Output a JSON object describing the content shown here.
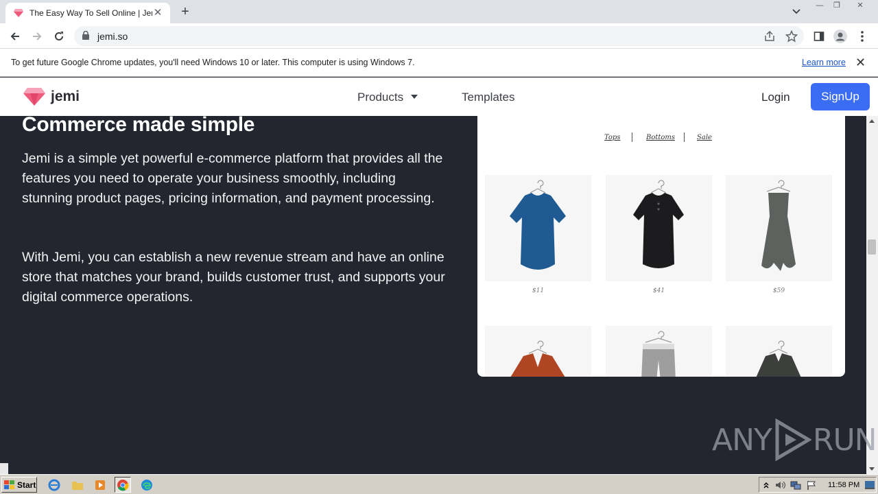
{
  "browser": {
    "tab": {
      "title": "The Easy Way To Sell Online | Jemi",
      "close": "✕"
    },
    "new_tab": "+",
    "url": "jemi.so",
    "window_controls": {
      "minimize": "—",
      "maximize": "❐",
      "close": "✕"
    }
  },
  "infobar": {
    "message": "To get future Google Chrome updates, you'll need Windows 10 or later. This computer is using Windows 7.",
    "link": "Learn more",
    "close": "✕"
  },
  "site_nav": {
    "logo_text": "jemi",
    "products": "Products",
    "templates": "Templates",
    "login": "Login",
    "signup": "SignUp"
  },
  "hero": {
    "heading": "Commerce made simple",
    "paragraph_1": "Jemi is a simple yet powerful e-commerce platform that provides all the features you need to operate your business smoothly, including stunning product pages, pricing information, and payment processing.",
    "paragraph_2": "With Jemi, you can establish a new revenue stream and have an online store that matches your brand, builds customer trust, and supports your digital commerce operations."
  },
  "store_preview": {
    "nav": [
      "Tops",
      "Bottoms",
      "Sale"
    ],
    "products": [
      {
        "price": "$11",
        "color": "#1f5a93"
      },
      {
        "price": "$41",
        "color": "#1c1c1e"
      },
      {
        "price": "$59",
        "color": "#5d625e"
      },
      {
        "price": "",
        "color": "#b04524"
      },
      {
        "price": "",
        "color": "#9e9e9e"
      },
      {
        "price": "",
        "color": "#3d3f3d"
      }
    ]
  },
  "watermark": {
    "text_left": "ANY",
    "text_right": "RUN"
  },
  "taskbar": {
    "start": "Start",
    "clock": "11:58 PM"
  },
  "colors": {
    "hero_bg": "#23262f",
    "signup_bg": "#3a6cf4",
    "logo_gem": "#ef5b7b"
  }
}
